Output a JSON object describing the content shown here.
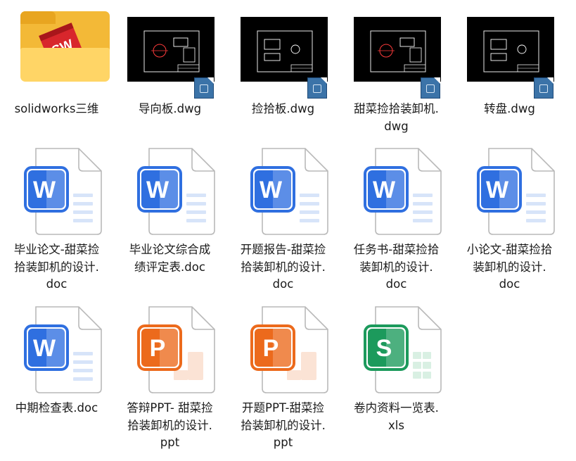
{
  "files": [
    {
      "id": "f0",
      "type": "folder",
      "name": "solidworks三维",
      "badge": "SW"
    },
    {
      "id": "f1",
      "type": "dwg",
      "name": "导向板.dwg"
    },
    {
      "id": "f2",
      "type": "dwg",
      "name": "捡拾板.dwg"
    },
    {
      "id": "f3",
      "type": "dwg",
      "name": "甜菜捡拾装卸机.\ndwg"
    },
    {
      "id": "f4",
      "type": "dwg",
      "name": "转盘.dwg"
    },
    {
      "id": "f5",
      "type": "doc",
      "name": "毕业论文-甜菜捡\n拾装卸机的设计.\ndoc",
      "letter": "W"
    },
    {
      "id": "f6",
      "type": "doc",
      "name": "毕业论文综合成\n绩评定表.doc",
      "letter": "W"
    },
    {
      "id": "f7",
      "type": "doc",
      "name": "开题报告-甜菜捡\n拾装卸机的设计.\ndoc",
      "letter": "W"
    },
    {
      "id": "f8",
      "type": "doc",
      "name": "任务书-甜菜捡拾\n装卸机的设计.\ndoc",
      "letter": "W"
    },
    {
      "id": "f9",
      "type": "doc",
      "name": "小论文-甜菜捡拾\n装卸机的设计.\ndoc",
      "letter": "W"
    },
    {
      "id": "f10",
      "type": "doc",
      "name": "中期检查表.doc",
      "letter": "W"
    },
    {
      "id": "f11",
      "type": "ppt",
      "name": "答辩PPT- 甜菜捡\n拾装卸机的设计.\nppt",
      "letter": "P"
    },
    {
      "id": "f12",
      "type": "ppt",
      "name": "开题PPT-甜菜捡\n拾装卸机的设计.\nppt",
      "letter": "P"
    },
    {
      "id": "f13",
      "type": "xls",
      "name": "卷内资料一览表.\nxls",
      "letter": "S"
    }
  ],
  "colors": {
    "word": "#2f6fe0",
    "ppt": "#ec6a1c",
    "xls": "#1c9a5c",
    "folder": "#f3b937",
    "sw": "#d8262c"
  }
}
